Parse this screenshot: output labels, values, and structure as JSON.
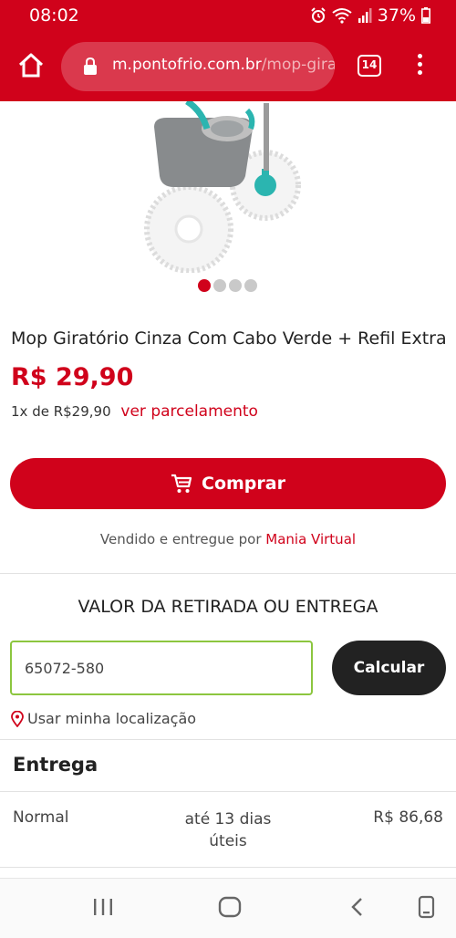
{
  "status_bar": {
    "time": "08:02",
    "battery": "37%",
    "icons": [
      "alarm-icon",
      "wifi-icon",
      "signal-icon",
      "battery-icon"
    ]
  },
  "browser": {
    "url_domain": "m.pontofrio.com.br",
    "url_path": "/mop-gira",
    "tab_count": "14",
    "icons": [
      "home-icon",
      "lock-icon",
      "tabs-icon",
      "more-menu-icon"
    ]
  },
  "product": {
    "image_alt": "mop-bucket-image",
    "dots_total": 4,
    "dots_active_index": 0,
    "title": "Mop Giratório Cinza Com Cabo Verde + Refil Extra",
    "price": "R$ 29,90",
    "installments_text": "1x de R$29,90",
    "installments_link": "ver parcelamento"
  },
  "buy": {
    "label": "Comprar",
    "icon": "cart-icon"
  },
  "seller": {
    "prefix": "Vendido e entregue por",
    "name": "Mania Virtual"
  },
  "delivery": {
    "heading": "VALOR DA RETIRADA OU ENTREGA",
    "cep_value": "65072-580",
    "calc_label": "Calcular",
    "use_location_label": "Usar minha localização",
    "section_title": "Entrega",
    "rows": [
      {
        "type": "Normal",
        "eta": "até 13 dias úteis",
        "price": "R$ 86,68"
      }
    ]
  },
  "colors": {
    "brand": "#d0021b",
    "input_border": "#8cc63f",
    "dark_button": "#222222"
  },
  "nav_bar": {
    "icons": [
      "recent-apps-icon",
      "home-nav-icon",
      "back-icon",
      "screen-icon"
    ]
  }
}
